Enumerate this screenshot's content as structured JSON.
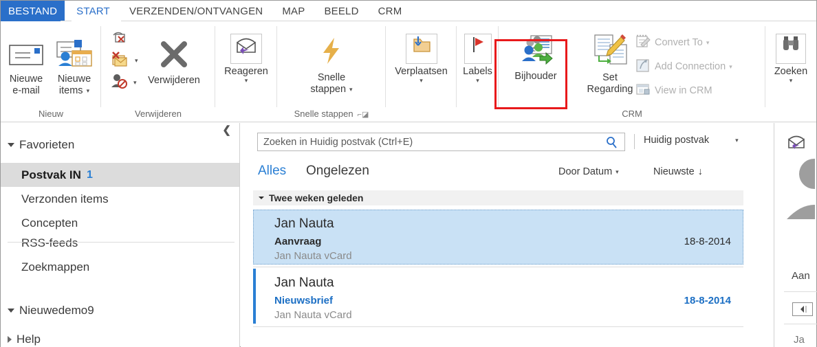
{
  "ribbon": {
    "tabs": [
      {
        "label": "BESTAND",
        "state": "file"
      },
      {
        "label": "START",
        "state": "active"
      },
      {
        "label": "VERZENDEN/ONTVANGEN",
        "state": "normal"
      },
      {
        "label": "MAP",
        "state": "normal"
      },
      {
        "label": "BEELD",
        "state": "normal"
      },
      {
        "label": "CRM",
        "state": "normal"
      }
    ],
    "groups": [
      {
        "name": "Nieuw",
        "label": "Nieuw",
        "buttons": [
          {
            "label_line1": "Nieuwe",
            "label_line2": "e-mail",
            "icon": "new-email-icon",
            "caret": false
          },
          {
            "label_line1": "Nieuwe",
            "label_line2": "items",
            "icon": "new-items-icon",
            "caret": true
          }
        ]
      },
      {
        "name": "Verwijderen",
        "label": "Verwijderen",
        "small_buttons": [
          {
            "label": "",
            "icon": "ignore-icon",
            "caret": false
          },
          {
            "label": "",
            "icon": "cleanup-icon",
            "caret": true
          },
          {
            "label": "",
            "icon": "junk-icon",
            "caret": true
          }
        ],
        "buttons": [
          {
            "label_line1": "Verwijderen",
            "label_line2": "",
            "icon": "delete-x-icon",
            "caret": false
          }
        ]
      },
      {
        "name": "Reageren",
        "label": "",
        "buttons": [
          {
            "label_line1": "Reageren",
            "label_line2": "",
            "icon": "reply-icon",
            "caret": true
          }
        ]
      },
      {
        "name": "Snelle stappen",
        "label": "Snelle stappen",
        "dialog_launcher": true,
        "buttons": [
          {
            "label_line1": "Snelle",
            "label_line2": "stappen",
            "icon": "lightning-icon",
            "caret": true
          }
        ]
      },
      {
        "name": "Verplaatsen",
        "label": "",
        "buttons": [
          {
            "label_line1": "Verplaatsen",
            "label_line2": "",
            "icon": "move-folder-icon",
            "caret": true
          }
        ]
      },
      {
        "name": "Labels",
        "label": "",
        "buttons": [
          {
            "label_line1": "Labels",
            "label_line2": "",
            "icon": "flag-icon",
            "caret": true
          }
        ]
      },
      {
        "name": "CRM",
        "label": "CRM",
        "buttons": [
          {
            "label_line1": "Bijhouder",
            "label_line2": "",
            "icon": "track-contacts-icon",
            "caret": false,
            "highlighted": true
          },
          {
            "label_line1": "Set",
            "label_line2": "Regarding",
            "icon": "set-regarding-icon",
            "caret": false
          }
        ],
        "small_buttons": [
          {
            "label": "Convert To",
            "icon": "convert-to-icon",
            "caret": true,
            "disabled": true
          },
          {
            "label": "Add Connection",
            "icon": "add-connection-icon",
            "caret": true,
            "disabled": true
          },
          {
            "label": "View in CRM",
            "icon": "view-in-crm-icon",
            "caret": false,
            "disabled": true
          }
        ]
      },
      {
        "name": "Zoeken",
        "label": "",
        "buttons": [
          {
            "label_line1": "Zoeken",
            "label_line2": "",
            "icon": "binoculars-icon",
            "caret": true
          }
        ]
      }
    ]
  },
  "nav": {
    "collapse_icon": "chevron-left-icon",
    "favorites_header": "Favorieten",
    "items": [
      {
        "label": "Postvak IN",
        "count": "1",
        "selected": true
      },
      {
        "label": "Verzonden items",
        "count": "",
        "selected": false
      },
      {
        "label": "Concepten",
        "count": "",
        "selected": false
      },
      {
        "label": "RSS-feeds",
        "count": "",
        "selected": false
      },
      {
        "label": "Zoekmappen",
        "count": "",
        "selected": false
      }
    ],
    "account_header": "Nieuwedemo9",
    "help_header": "Help"
  },
  "search": {
    "placeholder": "Zoeken in Huidig postvak (Ctrl+E)",
    "icon": "search-icon",
    "scope_label": "Huidig postvak",
    "scope_caret": "chevron-down-icon"
  },
  "filters": {
    "all_label": "Alles",
    "unread_label": "Ongelezen",
    "sort_label": "Door Datum",
    "order_label": "Nieuwste",
    "order_arrow": "arrow-down-icon"
  },
  "maillist": {
    "group_header": "Twee weken geleden",
    "messages": [
      {
        "from": "Jan Nauta",
        "subject": "Aanvraag",
        "preview": "Jan Nauta  vCard",
        "date": "18-8-2014",
        "selected": true,
        "unread": false
      },
      {
        "from": "Jan Nauta",
        "subject": "Nieuwsbrief",
        "preview": "Jan Nauta  vCard",
        "date": "18-8-2014",
        "selected": false,
        "unread": true
      }
    ]
  },
  "reading_pane": {
    "reply_icon": "reply-icon",
    "avatar": "person-silhouette-avatar",
    "to_label": "Aan",
    "nav_back_icon": "arrow-left-icon",
    "bottom_text": "Ja"
  },
  "colors": {
    "accent": "#2a6fc9",
    "link": "#2a7fd4",
    "highlight_box": "#e8191b",
    "selection_bg": "#c9e1f5",
    "nav_selected_bg": "#dcdcdc"
  }
}
